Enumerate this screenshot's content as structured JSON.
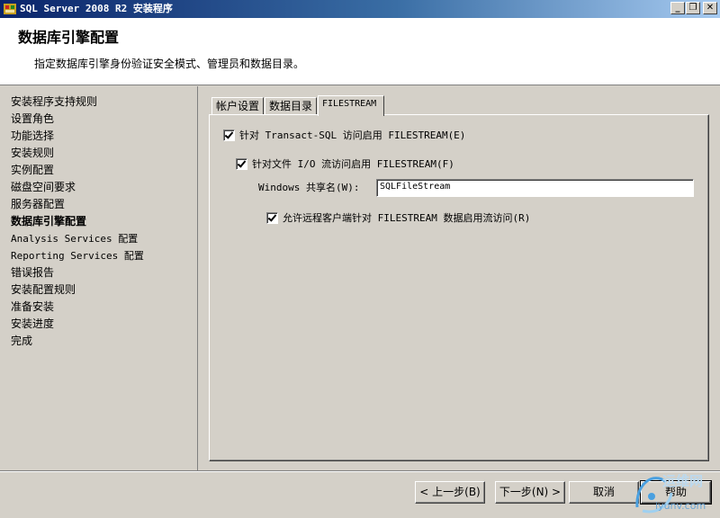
{
  "window": {
    "title": "SQL Server 2008 R2 安装程序",
    "buttons": {
      "minimize": "_",
      "restore": "❐",
      "close": "✕"
    }
  },
  "header": {
    "title": "数据库引擎配置",
    "description": "指定数据库引擎身份验证安全模式、管理员和数据目录。"
  },
  "sidebar": {
    "items": [
      {
        "label": "安装程序支持规则",
        "active": false
      },
      {
        "label": "设置角色",
        "active": false
      },
      {
        "label": "功能选择",
        "active": false
      },
      {
        "label": "安装规则",
        "active": false
      },
      {
        "label": "实例配置",
        "active": false
      },
      {
        "label": "磁盘空间要求",
        "active": false
      },
      {
        "label": "服务器配置",
        "active": false
      },
      {
        "label": "数据库引擎配置",
        "active": true
      },
      {
        "label": "Analysis Services 配置",
        "active": false
      },
      {
        "label": "Reporting Services 配置",
        "active": false
      },
      {
        "label": "错误报告",
        "active": false
      },
      {
        "label": "安装配置规则",
        "active": false
      },
      {
        "label": "准备安装",
        "active": false
      },
      {
        "label": "安装进度",
        "active": false
      },
      {
        "label": "完成",
        "active": false
      }
    ]
  },
  "tabs": [
    {
      "label": "帐户设置",
      "active": false
    },
    {
      "label": "数据目录",
      "active": false
    },
    {
      "label": "FILESTREAM",
      "active": true
    }
  ],
  "filestream": {
    "enable_tsql": {
      "label": "针对 Transact-SQL 访问启用 FILESTREAM(E)",
      "checked": true
    },
    "enable_file_io": {
      "label": "针对文件 I/O 流访问启用 FILESTREAM(F)",
      "checked": true
    },
    "share_name_label": "Windows 共享名(W):",
    "share_name_value": "SQLFileStream",
    "allow_remote": {
      "label": "允许远程客户端针对 FILESTREAM 数据启用流访问(R)",
      "checked": true
    }
  },
  "footer": {
    "back": "< 上一步(B)",
    "next": "下一步(N) >",
    "cancel": "取消",
    "help": "帮助"
  },
  "watermark": {
    "text1": "运维网",
    "text2": "iyunv.com"
  }
}
